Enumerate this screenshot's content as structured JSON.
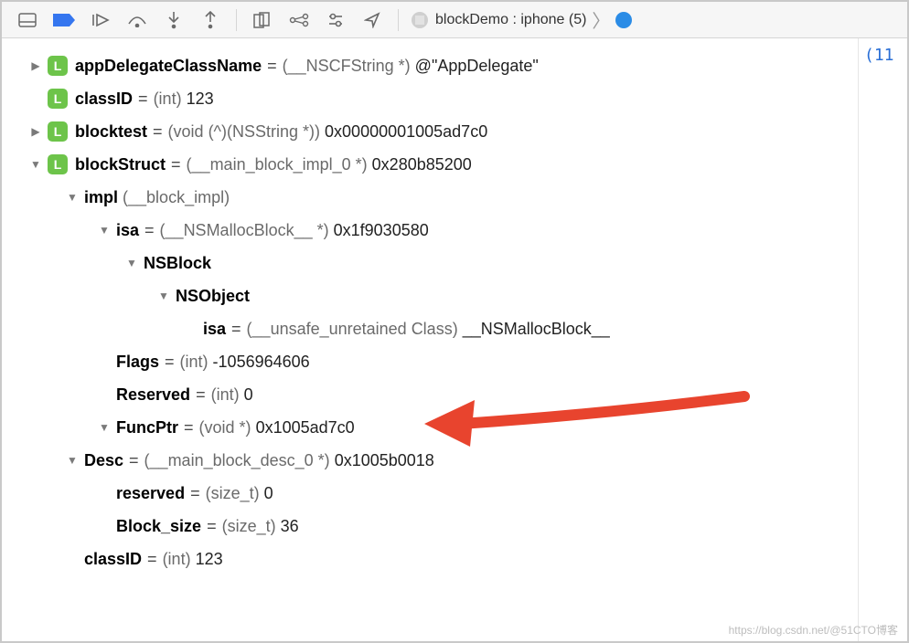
{
  "toolbar": {
    "breadcrumb": {
      "project": "blockDemo : iphone (5)"
    }
  },
  "right_margin_text": "(11",
  "vars": {
    "appDelegate": {
      "name": "appDelegateClassName",
      "type": "(__NSCFString *)",
      "value": "@\"AppDelegate\""
    },
    "classID": {
      "name": "classID",
      "type": "(int)",
      "value": "123"
    },
    "blocktest": {
      "name": "blocktest",
      "type": "(void (^)(NSString *))",
      "value": "0x00000001005ad7c0"
    },
    "blockStruct": {
      "name": "blockStruct",
      "type": "(__main_block_impl_0 *)",
      "value": "0x280b85200"
    },
    "impl": {
      "name": "impl",
      "type": "(__block_impl)"
    },
    "impl_isa": {
      "name": "isa",
      "type": "(__NSMallocBlock__ *)",
      "value": "0x1f9030580"
    },
    "nsblock": {
      "name": "NSBlock"
    },
    "nsobject": {
      "name": "NSObject"
    },
    "nsobject_isa": {
      "name": "isa",
      "type": "(__unsafe_unretained Class)",
      "value": "__NSMallocBlock__"
    },
    "flags": {
      "name": "Flags",
      "type": "(int)",
      "value": "-1056964606"
    },
    "reserved": {
      "name": "Reserved",
      "type": "(int)",
      "value": "0"
    },
    "funcptr": {
      "name": "FuncPtr",
      "type": "(void *)",
      "value": "0x1005ad7c0"
    },
    "desc": {
      "name": "Desc",
      "type": "(__main_block_desc_0 *)",
      "value": "0x1005b0018"
    },
    "desc_reserved": {
      "name": "reserved",
      "type": "(size_t)",
      "value": "0"
    },
    "block_size": {
      "name": "Block_size",
      "type": "(size_t)",
      "value": "36"
    },
    "struct_classID": {
      "name": "classID",
      "type": "(int)",
      "value": "123"
    }
  },
  "badge_letter": "L",
  "watermark": "https://blog.csdn.net/@51CTO博客"
}
